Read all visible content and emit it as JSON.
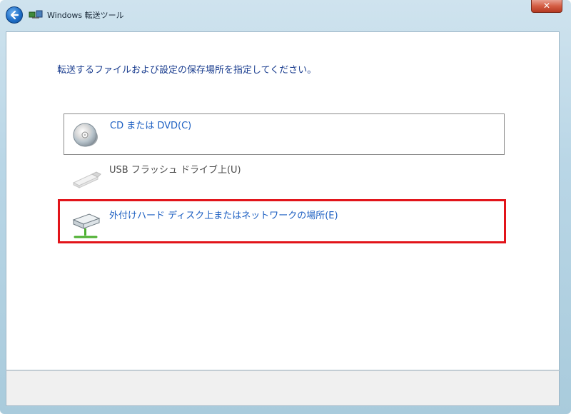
{
  "window": {
    "title": "Windows 転送ツール",
    "close_label": "✕"
  },
  "main": {
    "instruction": "転送するファイルおよび設定の保存場所を指定してください。",
    "options": [
      {
        "label": "CD または DVD(C)",
        "icon": "cd-dvd-icon",
        "selected": false
      },
      {
        "label": "USB フラッシュ ドライブ上(U)",
        "icon": "usb-drive-icon",
        "selected": false
      },
      {
        "label": "外付けハード ディスク上またはネットワークの場所(E)",
        "icon": "network-drive-icon",
        "selected": true
      }
    ]
  },
  "colors": {
    "link": "#1c5fc2",
    "instruction": "#1a3d8f",
    "highlight": "#e2141a"
  }
}
